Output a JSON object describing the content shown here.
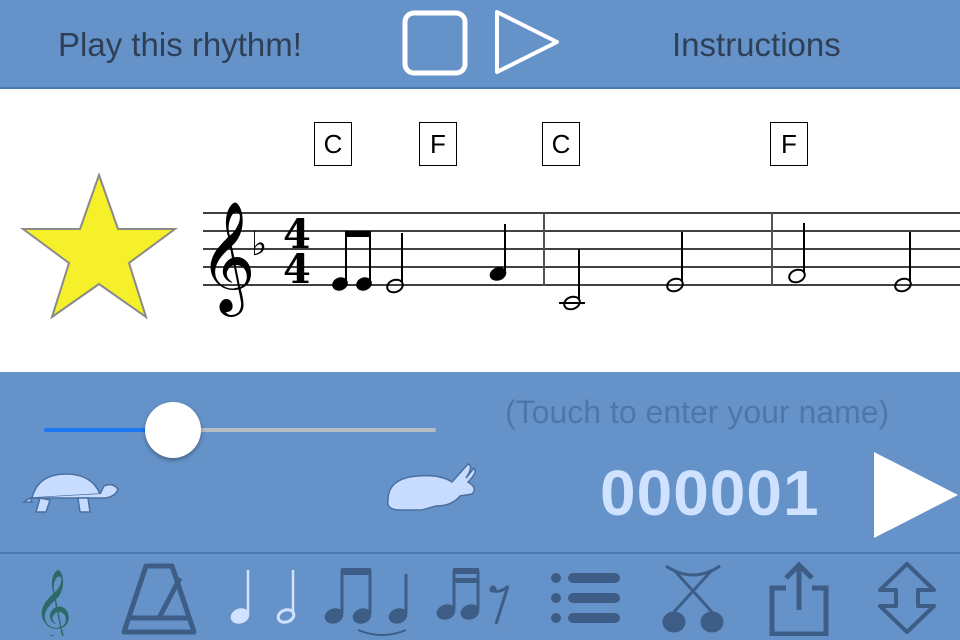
{
  "header": {
    "title": "Play this rhythm!",
    "instructions_label": "Instructions"
  },
  "score": {
    "chords": [
      "C",
      "F",
      "C",
      "F"
    ],
    "time_signature_top": "4",
    "time_signature_bottom": "4"
  },
  "controls": {
    "name_placeholder": "(Touch to enter your name)",
    "counter": "000001",
    "tempo_slider_value": 0.33
  },
  "colors": {
    "background": "#6593c9",
    "star": "#f5f02a",
    "counter": "#cfe2ff",
    "slider_active": "#1c77f2"
  },
  "toolbar": {
    "icons": [
      "treble-clef-icon",
      "metronome-icon",
      "note-values-icon",
      "beamed-notes-icon",
      "rest-icon",
      "list-icon",
      "tie-icon",
      "share-icon",
      "expand-icon"
    ]
  }
}
